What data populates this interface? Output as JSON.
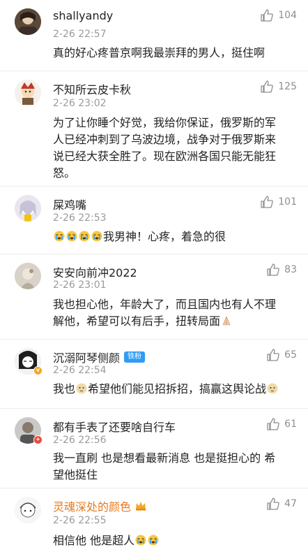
{
  "comments": [
    {
      "user": "shallyandy",
      "time": "2-26 22:57",
      "likes": "104",
      "text": "真的好心疼普京啊我最崇拜的男人，挺住啊"
    },
    {
      "user": "不知所云皮卡秋",
      "time": "2-26 23:02",
      "likes": "125",
      "text": "为了让你睡个好觉，我给你保证，俄罗斯的军人已经冲刺到了乌波边境，战争对于俄罗斯来说已经大获全胜了。现在欧洲各国只能无能狂怒。"
    },
    {
      "user": "屎鸡嘴",
      "time": "2-26 22:53",
      "likes": "101",
      "text": "我男神！心疼，着急的很"
    },
    {
      "user": "安安向前冲2022",
      "time": "2-26 23:01",
      "likes": "83",
      "text": "我也担心他，年龄大了，而且国内也有人不理解他，希望可以有后手，扭转局面"
    },
    {
      "user": "沉溺阿琴侧颜",
      "tag": "铁粉",
      "time": "2-26 22:54",
      "likes": "65",
      "text_a": "我也",
      "text_b": "希望他们能见招拆招，搞赢这舆论战"
    },
    {
      "user": "都有手表了还要啥自行车",
      "time": "2-26 22:56",
      "likes": "61",
      "text": "我一直刷 也是想看最新消息 也是挺担心的 希望他挺住"
    },
    {
      "user": "灵魂深处的颜色",
      "time": "2-26 22:55",
      "likes": "47",
      "text": "相信他 他是超人"
    }
  ]
}
